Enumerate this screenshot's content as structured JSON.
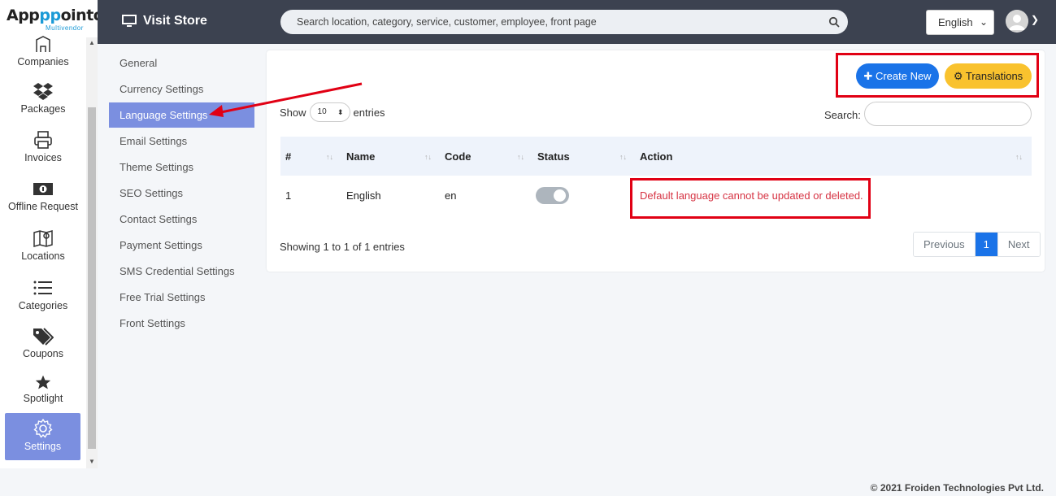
{
  "brand": {
    "name_a": "App",
    "name_b": "pp",
    "name_c": "ointo",
    "sub": "Multivendor"
  },
  "sidebar": {
    "items": [
      {
        "label": "Companies",
        "icon": "building-icon"
      },
      {
        "label": "Packages",
        "icon": "dropbox-icon"
      },
      {
        "label": "Invoices",
        "icon": "printer-icon"
      },
      {
        "label": "Offline Request",
        "icon": "money-bill-icon"
      },
      {
        "label": "Locations",
        "icon": "map-icon"
      },
      {
        "label": "Categories",
        "icon": "list-icon"
      },
      {
        "label": "Coupons",
        "icon": "tags-icon"
      },
      {
        "label": "Spotlight",
        "icon": "star-icon"
      },
      {
        "label": "Settings",
        "icon": "gear-icon"
      }
    ]
  },
  "topbar": {
    "visit_store": "Visit Store",
    "search_placeholder": "Search location, category, service, customer, employee, front page",
    "language": "English"
  },
  "submenu": {
    "items": [
      "General",
      "Currency Settings",
      "Language Settings",
      "Email Settings",
      "Theme Settings",
      "SEO Settings",
      "Contact Settings",
      "Payment Settings",
      "SMS Credential Settings",
      "Free Trial Settings",
      "Front Settings"
    ],
    "active_index": 2
  },
  "card": {
    "create_label": "Create New",
    "translations_label": "Translations",
    "show_label": "Show",
    "entries_value": "10",
    "entries_label": "entries",
    "search_label": "Search:",
    "columns": [
      "#",
      "Name",
      "Code",
      "Status",
      "Action"
    ],
    "rows": [
      {
        "num": "1",
        "name": "English",
        "code": "en",
        "status": "on",
        "action": "Default language cannot be updated or deleted."
      }
    ],
    "showing": "Showing 1 to 1 of 1 entries",
    "pager": {
      "prev": "Previous",
      "current": "1",
      "next": "Next"
    }
  },
  "footer": "© 2021 Froiden Technologies Pvt Ltd.",
  "colors": {
    "accent": "#7b8fe0",
    "primary": "#1a73e8",
    "warning": "#f9c22e",
    "danger": "#d63343",
    "annotation": "#e10014"
  }
}
